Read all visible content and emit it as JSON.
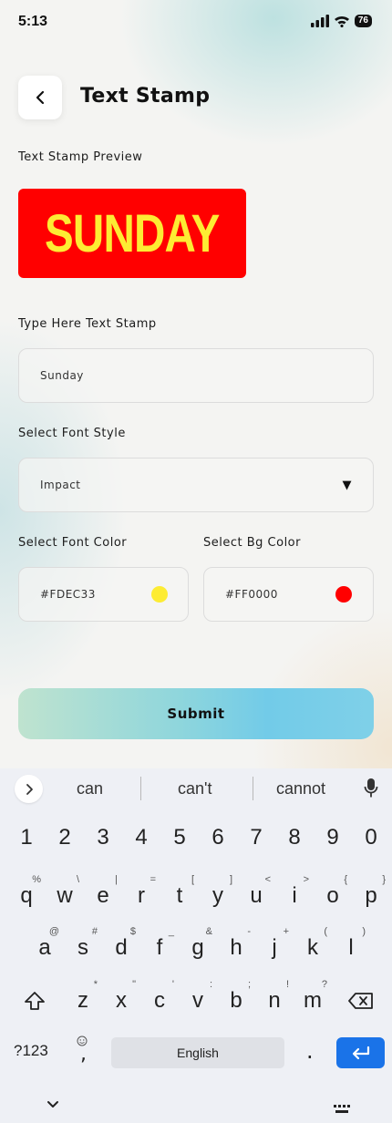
{
  "status": {
    "time": "5:13",
    "battery": "76"
  },
  "header": {
    "title": "Text Stamp"
  },
  "preview": {
    "label": "Text Stamp Preview",
    "text": "SUNDAY",
    "font_color": "#FDEC33",
    "bg_color": "#FF0000"
  },
  "stamp_text": {
    "label": "Type Here Text Stamp",
    "value": "Sunday"
  },
  "font_style": {
    "label": "Select Font Style",
    "value": "Impact"
  },
  "font_color": {
    "label": "Select Font Color",
    "value": "#FDEC33",
    "swatch": "#FDEC33"
  },
  "bg_color": {
    "label": "Select Bg Color",
    "value": "#FF0000",
    "swatch": "#FF0000"
  },
  "submit": {
    "label": "Submit"
  },
  "keyboard": {
    "suggestions": [
      "can",
      "can't",
      "cannot"
    ],
    "numbers": [
      "1",
      "2",
      "3",
      "4",
      "5",
      "6",
      "7",
      "8",
      "9",
      "0"
    ],
    "row1": [
      "q",
      "w",
      "e",
      "r",
      "t",
      "y",
      "u",
      "i",
      "o",
      "p"
    ],
    "row1_hints": [
      "%",
      "\\",
      "|",
      "=",
      "[",
      "]",
      "<",
      ">",
      "{",
      "}"
    ],
    "row2": [
      "a",
      "s",
      "d",
      "f",
      "g",
      "h",
      "j",
      "k",
      "l"
    ],
    "row2_hints": [
      "@",
      "#",
      "$",
      "_",
      "&",
      "-",
      "+",
      "(",
      ")"
    ],
    "row3": [
      "z",
      "x",
      "c",
      "v",
      "b",
      "n",
      "m"
    ],
    "row3_hints": [
      "*",
      "\"",
      "'",
      ":",
      ";",
      "!",
      "?"
    ],
    "symbols_key": "?123",
    "comma_key": ",",
    "space_label": "English",
    "period_key": "."
  }
}
